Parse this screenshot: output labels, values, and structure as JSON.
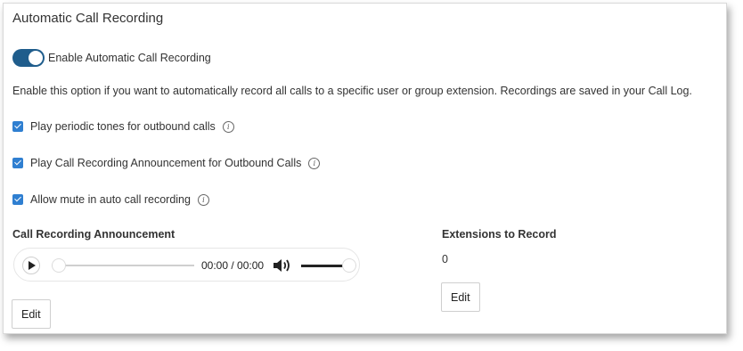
{
  "panel": {
    "title": "Automatic Call Recording"
  },
  "toggle": {
    "label": "Enable Automatic Call Recording",
    "state": "on",
    "color": "#1f5d8c"
  },
  "description": "Enable this option if you want to automatically record all calls to a specific user or group extension. Recordings are saved in your Call Log.",
  "options": [
    {
      "label": "Play periodic tones for outbound calls",
      "checked": true,
      "info_icon": "info-icon"
    },
    {
      "label": "Play Call Recording Announcement for Outbound Calls",
      "checked": true,
      "info_icon": "info-icon"
    },
    {
      "label": "Allow mute in auto call recording",
      "checked": true,
      "info_icon": "info-icon"
    }
  ],
  "announcement": {
    "heading": "Call Recording Announcement",
    "player": {
      "time": "00:00 / 00:00",
      "progress": 0,
      "volume": 1,
      "play_icon": "play-icon",
      "volume_icon": "volume-icon"
    },
    "edit_label": "Edit"
  },
  "extensions": {
    "heading": "Extensions to Record",
    "value": "0",
    "edit_label": "Edit"
  },
  "colors": {
    "checkbox": "#2f7fd1",
    "toggle": "#1f5d8c"
  }
}
